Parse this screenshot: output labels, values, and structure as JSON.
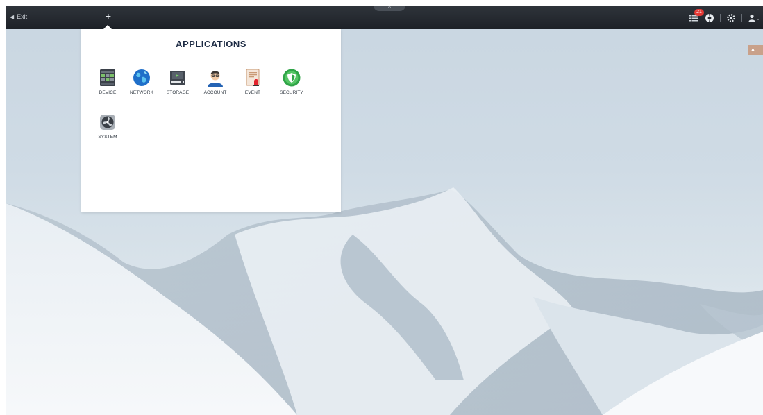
{
  "topbar": {
    "exit_label": "Exit",
    "add_tab_label": "+",
    "collapse_label": "^",
    "notification_count": "21"
  },
  "applications": {
    "title": "APPLICATIONS",
    "items": [
      {
        "label": "DEVICE",
        "icon": "device-icon"
      },
      {
        "label": "NETWORK",
        "icon": "network-globe-icon"
      },
      {
        "label": "STORAGE",
        "icon": "storage-icon"
      },
      {
        "label": "ACCOUNT",
        "icon": "account-icon"
      },
      {
        "label": "EVENT",
        "icon": "event-icon"
      },
      {
        "label": "SECURITY",
        "icon": "security-shield-icon"
      },
      {
        "label": "SYSTEM",
        "icon": "system-fan-icon"
      }
    ]
  },
  "colors": {
    "topbar": "#23272d",
    "badge": "#e53935",
    "panel": "#ffffff",
    "title": "#1d2b44"
  }
}
